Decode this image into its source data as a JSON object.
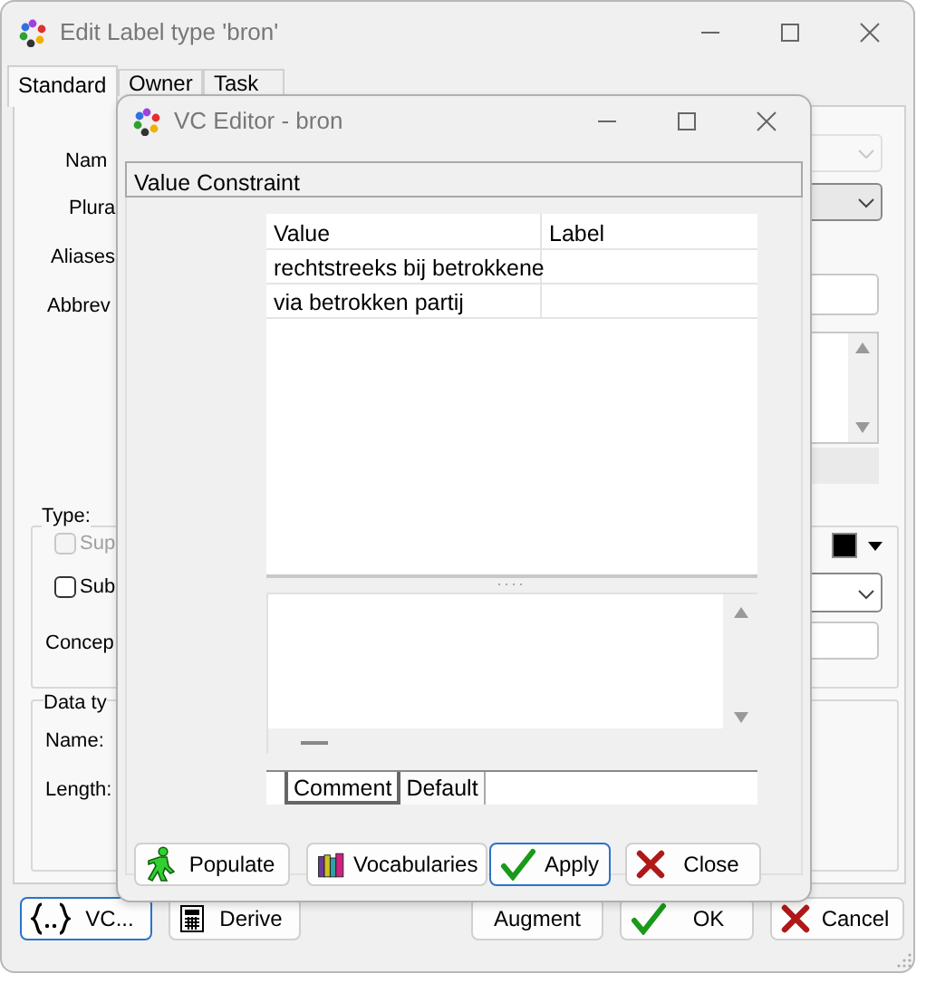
{
  "outer_window": {
    "title": "Edit Label type 'bron'",
    "tabs": [
      {
        "label": "Standard",
        "selected": true
      },
      {
        "label": "Owner",
        "selected": false
      },
      {
        "label": "Task",
        "selected": false
      }
    ],
    "field_labels": [
      "Nam",
      "Plura",
      "Aliases",
      "Abbrev"
    ],
    "type_group": {
      "title": "Type:",
      "checkboxes": [
        {
          "label": "Sup",
          "checked": false,
          "disabled": true
        },
        {
          "label": "Sub",
          "checked": false,
          "disabled": false
        }
      ],
      "concept_label": "Concep"
    },
    "data_type_group": {
      "title": "Data ty",
      "labels": [
        "Name:",
        "Length:"
      ]
    },
    "buttons": [
      {
        "label": "VC...",
        "kind": "braces",
        "default": true
      },
      {
        "label": "Derive",
        "kind": "calculator",
        "default": false
      },
      {
        "label": "Augment",
        "kind": "plain",
        "default": false
      },
      {
        "label": "OK",
        "kind": "check",
        "default": false
      },
      {
        "label": "Cancel",
        "kind": "cross",
        "default": false
      }
    ]
  },
  "vc_editor": {
    "title": "VC Editor - bron",
    "section": "Value Constraint",
    "table": {
      "columns": [
        "Value",
        "Label"
      ],
      "rows": [
        {
          "value": "rechtstreeks bij betrokkene"
        },
        {
          "value": "via betrokken partij"
        }
      ]
    },
    "tabs": [
      {
        "label": "Comment",
        "selected": true
      },
      {
        "label": "Default",
        "selected": false
      }
    ],
    "buttons": [
      {
        "label": "Populate",
        "kind": "walker",
        "default": false
      },
      {
        "label": "Vocabularies",
        "kind": "books",
        "default": false
      },
      {
        "label": "Apply",
        "kind": "check",
        "default": true
      },
      {
        "label": "Close",
        "kind": "cross",
        "default": false
      }
    ]
  }
}
